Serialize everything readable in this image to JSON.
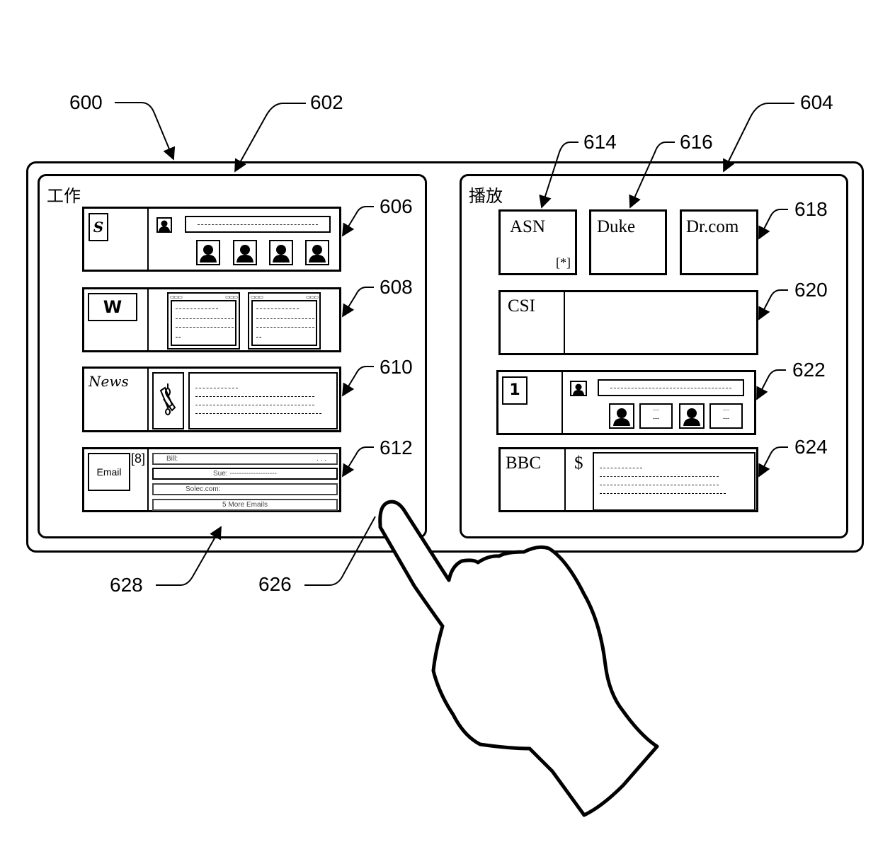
{
  "figure": {
    "reference_numerals": {
      "device": "600",
      "left_panel": "602",
      "right_panel": "604",
      "tile_social": "606",
      "tile_word": "608",
      "tile_news": "610",
      "tile_email": "612",
      "tile_asn": "614",
      "tile_duke": "616",
      "tile_drcom": "618",
      "tile_csi": "620",
      "tile_channel1": "622",
      "tile_bbc": "624",
      "finger": "626",
      "panel_gap": "628"
    }
  },
  "left_panel": {
    "title": "工作",
    "tiles": {
      "social": {
        "logo_letter": "S",
        "status_line": "------------------------------------------"
      },
      "word": {
        "logo_letter": "W",
        "doc_line_short": "------------------",
        "doc_line_long": "--------------------------",
        "doc_line_tail": "--"
      },
      "news": {
        "label": "News",
        "headline_short": "----------------",
        "headline_long": "------------------------------------------"
      },
      "email": {
        "label": "Email",
        "count_badge": "[8]",
        "messages": [
          {
            "text": "Bill:",
            "trailing": ". . ."
          },
          {
            "text": "Sue: --------------------"
          },
          {
            "text": "Solec.com:"
          },
          {
            "text": "5 More Emails"
          }
        ]
      }
    }
  },
  "right_panel": {
    "title": "播放",
    "tiles": {
      "asn": {
        "label": "ASN",
        "badge": "[*]"
      },
      "duke": {
        "label": "Duke"
      },
      "drcom": {
        "label": "Dr.com"
      },
      "csi": {
        "label": "CSI"
      },
      "channel1": {
        "logo_letter": "1",
        "status_line": "-------------------------------------------",
        "card_text_top": "---",
        "card_text_bottom": "---"
      },
      "bbc": {
        "label": "BBC",
        "currency_icon": "$",
        "line_short": "---------------",
        "line_long": "--------------------------------------------"
      }
    }
  }
}
